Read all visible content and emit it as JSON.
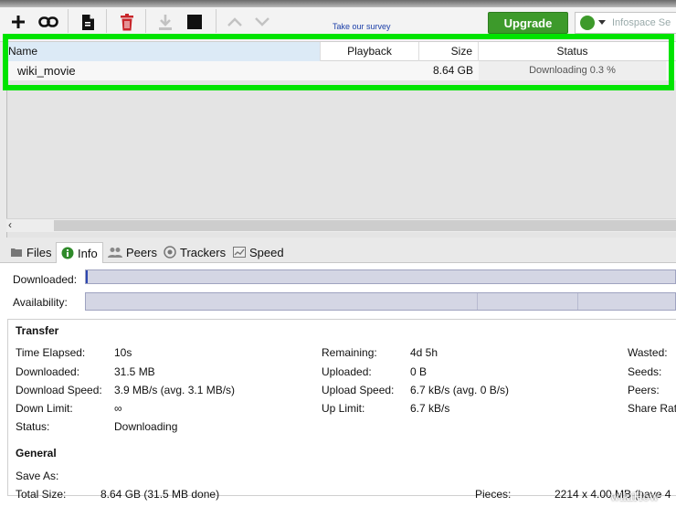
{
  "toolbar": {
    "survey_link": "Take our survey",
    "upgrade_label": "Upgrade",
    "search_placeholder": "Infospace Se"
  },
  "torrent_list": {
    "columns": [
      "Name",
      "Playback",
      "Size",
      "Status"
    ],
    "rows": [
      {
        "name": "wiki_movie",
        "playback": "",
        "size": "8.64 GB",
        "status": "Downloading 0.3 %"
      }
    ]
  },
  "tabs": [
    {
      "label": "Files",
      "icon": "files-icon"
    },
    {
      "label": "Info",
      "icon": "info-icon",
      "active": true
    },
    {
      "label": "Peers",
      "icon": "peers-icon"
    },
    {
      "label": "Trackers",
      "icon": "trackers-icon"
    },
    {
      "label": "Speed",
      "icon": "speed-icon"
    }
  ],
  "info": {
    "downloaded_label": "Downloaded:",
    "availability_label": "Availability:",
    "download_progress": 0.003,
    "transfer": {
      "title": "Transfer",
      "time_elapsed": {
        "label": "Time Elapsed:",
        "value": "10s"
      },
      "downloaded": {
        "label": "Downloaded:",
        "value": "31.5 MB"
      },
      "download_speed": {
        "label": "Download Speed:",
        "value": "3.9 MB/s (avg. 3.1 MB/s)"
      },
      "down_limit": {
        "label": "Down Limit:",
        "value": "∞"
      },
      "status": {
        "label": "Status:",
        "value": "Downloading"
      },
      "remaining": {
        "label": "Remaining:",
        "value": "4d 5h"
      },
      "uploaded": {
        "label": "Uploaded:",
        "value": "0 B"
      },
      "upload_speed": {
        "label": "Upload Speed:",
        "value": "6.7 kB/s (avg. 0 B/s)"
      },
      "up_limit": {
        "label": "Up Limit:",
        "value": "6.7 kB/s"
      },
      "wasted": {
        "label": "Wasted:"
      },
      "seeds": {
        "label": "Seeds:"
      },
      "peers": {
        "label": "Peers:"
      },
      "share_ratio": {
        "label": "Share Rat"
      }
    },
    "general": {
      "title": "General",
      "save_as": {
        "label": "Save As:"
      },
      "total_size": {
        "label": "Total Size:",
        "value": "8.64 GB (31.5 MB done)"
      },
      "pieces": {
        "label": "Pieces:",
        "value": "2214 x 4.00 MB (have 4"
      }
    }
  },
  "watermark": "wikiHow",
  "colors": {
    "highlight": "#00e400",
    "upgrade": "#3d9a2b",
    "delete": "#c8262b"
  }
}
